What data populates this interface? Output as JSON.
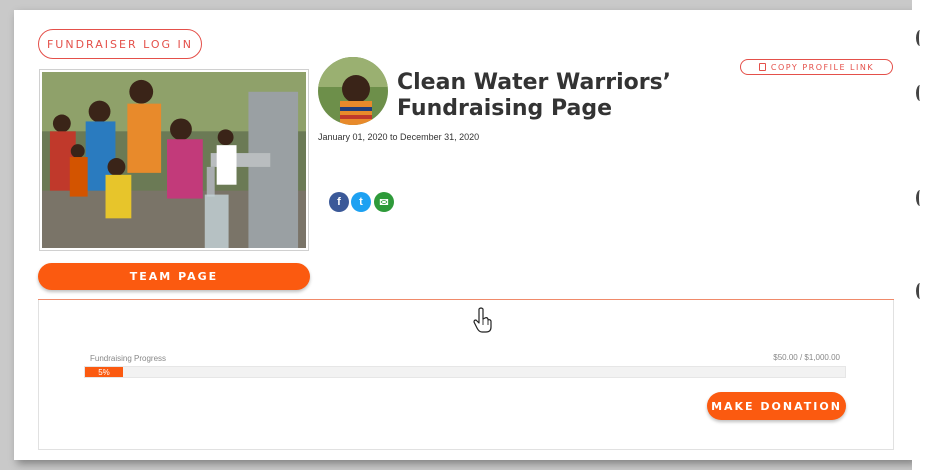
{
  "header": {
    "fundraiser_login_label": "FUNDRAISER LOG IN",
    "copy_profile_label": "COPY PROFILE LINK"
  },
  "profile": {
    "title": "Clean Water Warriors’ Fundraising Page",
    "dates": "January 01, 2020 to December 31, 2020",
    "team_page_label": "TEAM PAGE"
  },
  "social": {
    "facebook_glyph": "f",
    "twitter_glyph": "t",
    "email_glyph": "✉"
  },
  "progress": {
    "label": "Fundraising Progress",
    "amount": "$50.00 / $1,000.00",
    "percent_label": "5%",
    "fraction": 0.05
  },
  "actions": {
    "donate_label": "MAKE DONATION"
  },
  "colors": {
    "accent": "#fb5a10",
    "outline": "#e4504a",
    "facebook": "#3b5998",
    "twitter": "#1da1f2",
    "email": "#2e9a3a"
  },
  "icons": [
    "copy-icon",
    "facebook-icon",
    "twitter-icon",
    "email-icon",
    "hand-cursor-icon"
  ]
}
